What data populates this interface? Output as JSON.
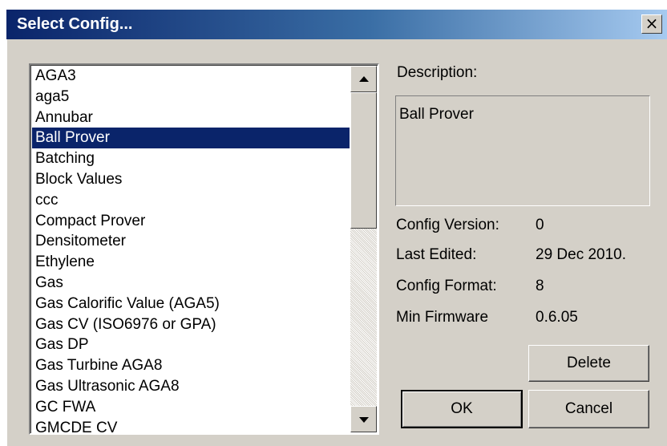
{
  "window": {
    "title": "Select Config...",
    "close_label": "×"
  },
  "list": {
    "selected_index": 3,
    "items": [
      "AGA3",
      "aga5",
      "Annubar",
      "Ball Prover",
      "Batching",
      "Block Values",
      "ccc",
      "Compact Prover",
      "Densitometer",
      "Ethylene",
      "Gas",
      "Gas Calorific Value (AGA5)",
      "Gas CV (ISO6976 or GPA)",
      "Gas DP",
      "Gas Turbine AGA8",
      "Gas Ultrasonic AGA8",
      "GC FWA",
      "GMCDE CV"
    ]
  },
  "details": {
    "description_label": "Description:",
    "description_value": "Ball Prover",
    "config_version_label": "Config Version:",
    "config_version_value": "0",
    "last_edited_label": "Last Edited:",
    "last_edited_value": "29 Dec 2010.",
    "config_format_label": "Config Format:",
    "config_format_value": "8",
    "min_firmware_label": "Min Firmware",
    "min_firmware_value": "0.6.05"
  },
  "buttons": {
    "delete": "Delete",
    "ok": "OK",
    "cancel": "Cancel"
  }
}
